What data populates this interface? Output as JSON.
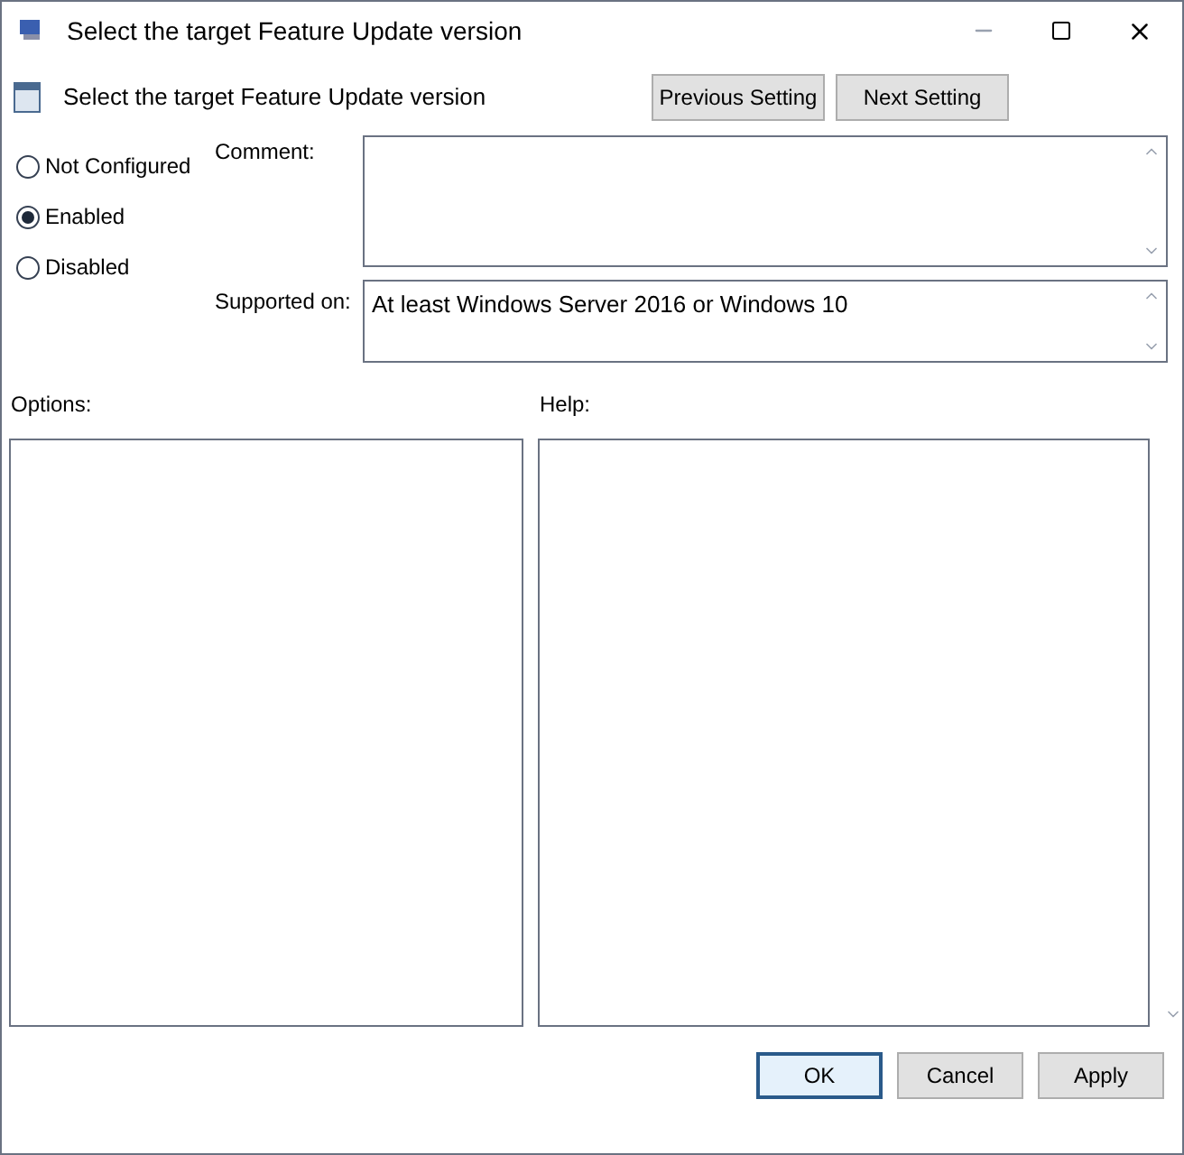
{
  "window": {
    "title": "Select the target Feature Update version"
  },
  "header": {
    "title": "Select the target Feature Update version"
  },
  "nav_buttons": [
    "Previous Setting",
    "Next Setting"
  ],
  "states": [
    {
      "label": "Not Configured",
      "selected": false
    },
    {
      "label": "Enabled",
      "selected": true
    },
    {
      "label": "Disabled",
      "selected": false
    }
  ],
  "comment": {
    "label": "Comment:"
  },
  "supported_on": {
    "label": "Supported on:",
    "value": "At least Windows Server 2016 or Windows 10"
  },
  "options": {
    "label": "Options:"
  },
  "help": {
    "label": "Help:"
  },
  "buttons": [
    {
      "label": "OK",
      "focused": true
    },
    {
      "label": "Cancel",
      "focused": false
    },
    {
      "label": "Apply",
      "focused": false
    }
  ]
}
